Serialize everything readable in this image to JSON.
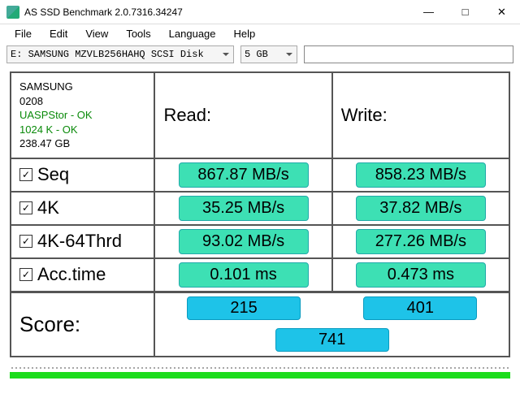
{
  "window": {
    "title": "AS SSD Benchmark 2.0.7316.34247"
  },
  "menu": {
    "file": "File",
    "edit": "Edit",
    "view": "View",
    "tools": "Tools",
    "language": "Language",
    "help": "Help"
  },
  "toolbar": {
    "disk": "E: SAMSUNG MZVLB256HAHQ SCSI Disk",
    "size": "5 GB"
  },
  "info": {
    "model": "SAMSUNG",
    "fw": "0208",
    "driver": "UASPStor - OK",
    "align": "1024 K - OK",
    "capacity": "238.47 GB"
  },
  "headers": {
    "read": "Read:",
    "write": "Write:"
  },
  "tests": {
    "seq": {
      "label": "Seq",
      "read": "867.87 MB/s",
      "write": "858.23 MB/s"
    },
    "fourk": {
      "label": "4K",
      "read": "35.25 MB/s",
      "write": "37.82 MB/s"
    },
    "fourk64": {
      "label": "4K-64Thrd",
      "read": "93.02 MB/s",
      "write": "277.26 MB/s"
    },
    "acc": {
      "label": "Acc.time",
      "read": "0.101 ms",
      "write": "0.473 ms"
    }
  },
  "score": {
    "label": "Score:",
    "read": "215",
    "write": "401",
    "total": "741"
  },
  "chart_data": {
    "type": "table",
    "title": "AS SSD Benchmark Results",
    "drive": "SAMSUNG MZVLB256HAHQ",
    "capacity_gb": 238.47,
    "tests": [
      {
        "name": "Seq",
        "read_mbs": 867.87,
        "write_mbs": 858.23
      },
      {
        "name": "4K",
        "read_mbs": 35.25,
        "write_mbs": 37.82
      },
      {
        "name": "4K-64Thrd",
        "read_mbs": 93.02,
        "write_mbs": 277.26
      },
      {
        "name": "Acc.time",
        "read_ms": 0.101,
        "write_ms": 0.473
      }
    ],
    "score": {
      "read": 215,
      "write": 401,
      "total": 741
    }
  }
}
